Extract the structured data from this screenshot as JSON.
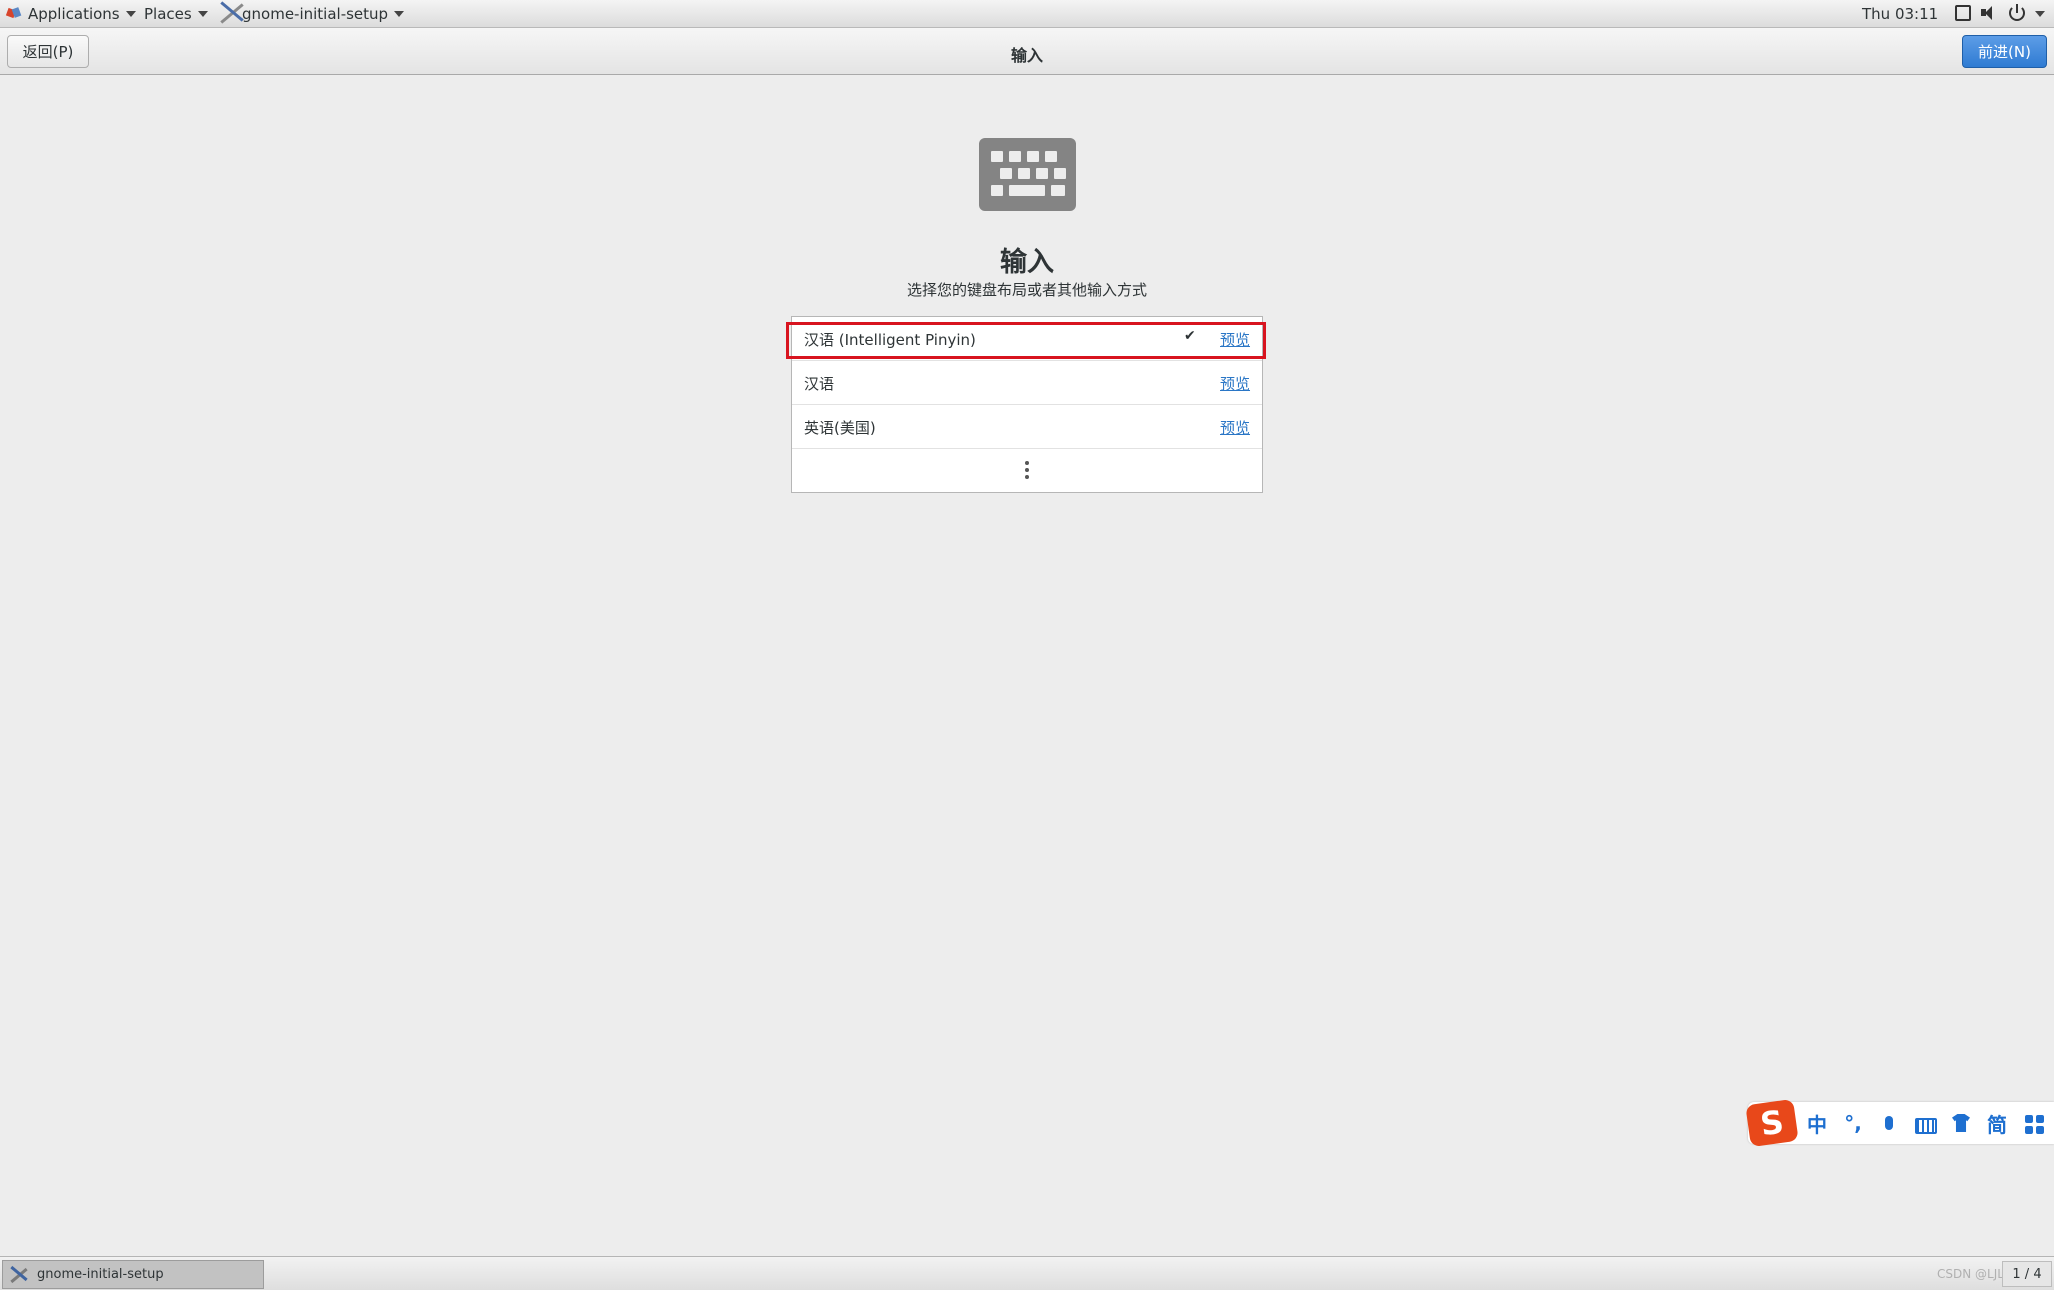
{
  "top_panel": {
    "applications": "Applications",
    "places": "Places",
    "app_menu": "gnome-initial-setup",
    "clock": "Thu 03:11"
  },
  "header": {
    "back_label": "返回(P)",
    "title": "输入",
    "next_label": "前进(N)"
  },
  "main": {
    "title": "输入",
    "subtitle": "选择您的键盘布局或者其他输入方式"
  },
  "input_sources": [
    {
      "label": "汉语 (Intelligent Pinyin)",
      "selected": true,
      "preview_label": "预览"
    },
    {
      "label": "汉语",
      "selected": false,
      "preview_label": "预览"
    },
    {
      "label": "英语(美国)",
      "selected": false,
      "preview_label": "预览"
    }
  ],
  "ime_toolbar": {
    "logo": "S",
    "mode": "中",
    "punct": "°,",
    "simplified": "简"
  },
  "taskbar": {
    "window_label": "gnome-initial-setup",
    "watermark": "CSDN @LJL",
    "workspace": "1 / 4"
  },
  "colors": {
    "accent": "#2f7bd2",
    "highlight": "#d8141f",
    "link": "#2a76c6",
    "ime": "#1e6fd0"
  }
}
